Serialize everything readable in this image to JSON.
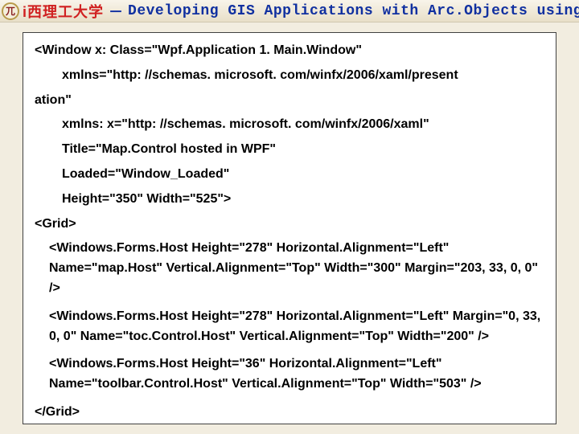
{
  "header": {
    "logo_glyph": "兀",
    "university": "i西理工大学",
    "separator": "－",
    "title": "Developing GIS Applications with Arc.Objects using C#. NE"
  },
  "code": {
    "l1": "<Window x: Class=\"Wpf.Application 1. Main.Window\"",
    "l2": "xmlns=\"http: //schemas. microsoft. com/winfx/2006/xaml/present",
    "l2b": "ation\"",
    "l3": "xmlns: x=\"http: //schemas. microsoft. com/winfx/2006/xaml\"",
    "l4": "Title=\"Map.Control hosted in WPF\"",
    "l5": "Loaded=\"Window_Loaded\"",
    "l6": "Height=\"350\" Width=\"525\">",
    "l7": "<Grid>",
    "l8": "<Windows.Forms.Host Height=\"278\" Horizontal.Alignment=\"Left\" Name=\"map.Host\" Vertical.Alignment=\"Top\" Width=\"300\" Margin=\"203, 33, 0, 0\" />",
    "l9": "<Windows.Forms.Host Height=\"278\" Horizontal.Alignment=\"Left\" Margin=\"0, 33, 0, 0\" Name=\"toc.Control.Host\" Vertical.Alignment=\"Top\" Width=\"200\" />",
    "l10": "<Windows.Forms.Host Height=\"36\" Horizontal.Alignment=\"Left\" Name=\"toolbar.Control.Host\" Vertical.Alignment=\"Top\" Width=\"503\" />",
    "l11": "</Grid>"
  }
}
